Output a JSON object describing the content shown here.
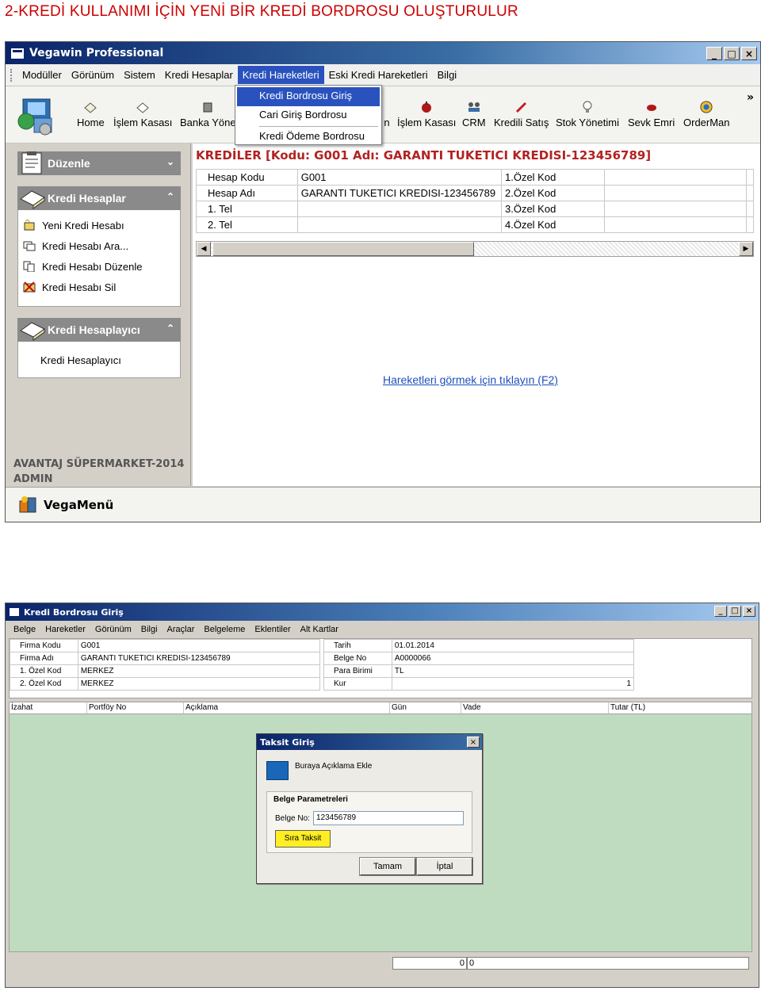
{
  "page_heading": "2-KREDİ KULLANIMI İÇİN YENİ BİR KREDİ BORDROSU OLUŞTURULUR",
  "window1": {
    "title": "Vegawin Professional",
    "menu": [
      "Modüller",
      "Görünüm",
      "Sistem",
      "Kredi Hesaplar",
      "Kredi Hareketleri",
      "Eski Kredi Hareketleri",
      "Bilgi"
    ],
    "active_menu": "Kredi Hareketleri",
    "dropdown": [
      "Kredi Bordrosu Giriş",
      "Cari Giriş Bordrosu",
      "Kredi Ödeme Bordrosu"
    ],
    "toolbar": [
      "Home",
      "İşlem Kasası",
      "Banka Yöne",
      "n",
      "İşlem Kasası",
      "CRM",
      "Kredili Satış",
      "Stok Yönetimi",
      "Sevk Emri",
      "OrderMan"
    ],
    "toolbar_more": "»",
    "sidebar": {
      "panel1": "Düzenle",
      "panel2": "Kredi Hesaplar",
      "panel2_items": [
        "Yeni Kredi Hesabı",
        "Kredi Hesabı Ara...",
        "Kredi Hesabı Düzenle",
        "Kredi Hesabı Sil"
      ],
      "panel3": "Kredi Hesaplayıcı",
      "panel3_items": [
        "Kredi Hesaplayıcı"
      ],
      "company": "AVANTAJ SÜPERMARKET-2014",
      "user": "ADMIN"
    },
    "main": {
      "title": "KREDİLER [Kodu: G001 Adı: GARANTI TUKETICI KREDISI-123456789]",
      "rows": [
        {
          "label": "Hesap Kodu",
          "value": "G001",
          "label2": "1.Özel Kod",
          "value2": ""
        },
        {
          "label": "Hesap Adı",
          "value": "GARANTI TUKETICI KREDISI-123456789",
          "label2": "2.Özel Kod",
          "value2": ""
        },
        {
          "label": "1. Tel",
          "value": "",
          "label2": "3.Özel Kod",
          "value2": ""
        },
        {
          "label": "2. Tel",
          "value": "",
          "label2": "4.Özel Kod",
          "value2": ""
        }
      ],
      "link": "Hareketleri görmek için tıklayın (F2)"
    },
    "status_label": "VegaMenü"
  },
  "window2": {
    "title": "Kredi Bordrosu Giriş",
    "menu": [
      "Belge",
      "Hareketler",
      "Görünüm",
      "Bilgi",
      "Araçlar",
      "Belgeleme",
      "Eklentiler",
      "Alt Kartlar"
    ],
    "form_left": [
      {
        "label": "Firma Kodu",
        "value": "G001"
      },
      {
        "label": "Firma Adı",
        "value": "GARANTI TUKETICI KREDISI-123456789"
      },
      {
        "label": "1. Özel Kod",
        "value": "MERKEZ"
      },
      {
        "label": "2. Özel Kod",
        "value": "MERKEZ"
      }
    ],
    "form_right": [
      {
        "label": "Tarih",
        "value": "01.01.2014"
      },
      {
        "label": "Belge No",
        "value": "A0000066"
      },
      {
        "label": "Para Birimi",
        "value": "TL"
      },
      {
        "label": "Kur",
        "value": "1"
      }
    ],
    "columns": [
      "İzahat",
      "Portföy No",
      "Açıklama",
      "Gün",
      "Vade",
      "Tutar (TL)"
    ],
    "footer": [
      "0",
      "0"
    ]
  },
  "dialog": {
    "title": "Taksit Giriş",
    "description": "Buraya Açıklama Ekle",
    "group_title": "Belge Parametreleri",
    "belge_no_label": "Belge No:",
    "belge_no_value": "123456789",
    "yellow_button": "Sıra Taksit",
    "ok": "Tamam",
    "cancel": "İptal"
  },
  "colors": {
    "heading": "#cc0000",
    "title_bar": "#0a246a",
    "menu_highlight": "#2a52be",
    "main_title": "#b22222",
    "link": "#1f4fbf",
    "grid_background": "#c0dcc0",
    "yellow_button": "#ffee22"
  }
}
